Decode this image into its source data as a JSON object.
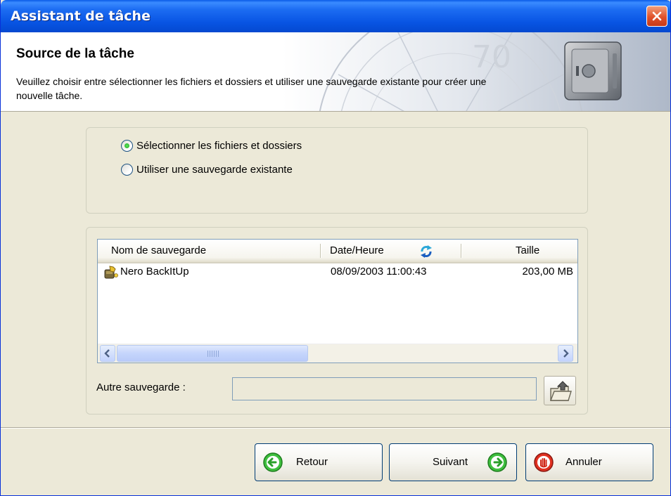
{
  "window": {
    "title": "Assistant de tâche"
  },
  "header": {
    "title": "Source de la tâche",
    "description": "Veuillez choisir entre sélectionner les fichiers et dossiers et utiliser une sauvegarde existante pour créer une nouvelle tâche."
  },
  "source_options": [
    {
      "label": "Sélectionner les fichiers et dossiers",
      "checked": true
    },
    {
      "label": "Utiliser une sauvegarde existante",
      "checked": false
    }
  ],
  "backup_list": {
    "columns": [
      "Nom de sauvegarde",
      "Date/Heure",
      "Taille"
    ],
    "rows": [
      {
        "name": "Nero BackItUp",
        "datetime": "08/09/2003 11:00:43",
        "size": "203,00 MB"
      }
    ]
  },
  "other_backup": {
    "label": "Autre sauvegarde :",
    "value": ""
  },
  "buttons": {
    "back": "Retour",
    "next": "Suivant",
    "cancel": "Annuler"
  },
  "colors": {
    "titlebar": "#0854e3",
    "dialog_bg": "#ece9d8",
    "close": "#e0512a"
  },
  "icons": [
    "close-icon",
    "safe-icon",
    "refresh-sort-icon",
    "backup-file-icon",
    "folder-up-icon",
    "arrow-left-icon",
    "arrow-right-icon",
    "stop-hand-icon"
  ]
}
